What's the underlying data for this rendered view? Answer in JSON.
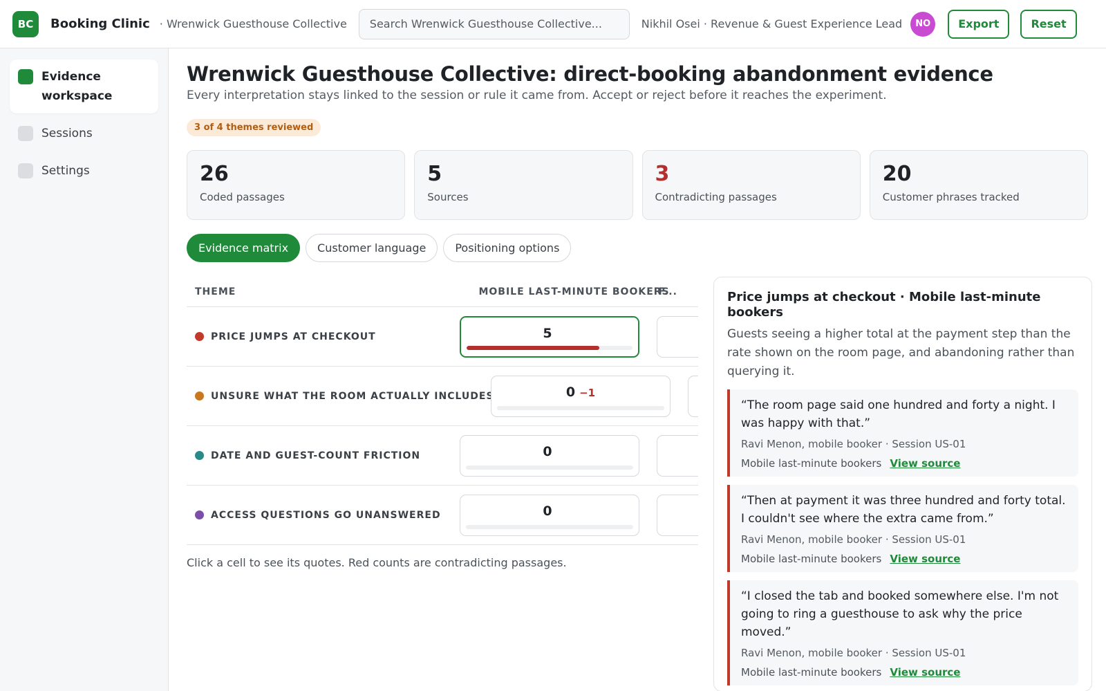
{
  "topbar": {
    "logo_text": "BC",
    "app_name": "Booking Clinic",
    "workspace_name": "· Wrenwick Guesthouse Collective",
    "search_placeholder": "Search Wrenwick Guesthouse Collective...",
    "user_label": "Nikhil Osei · Revenue & Guest Experience Lead",
    "avatar_initials": "NO",
    "avatar_color": "#c94bd1",
    "export_label": "Export",
    "reset_label": "Reset"
  },
  "sidebar": {
    "items": [
      {
        "label": "Evidence workspace",
        "active": true
      },
      {
        "label": "Sessions",
        "active": false
      },
      {
        "label": "Settings",
        "active": false
      }
    ]
  },
  "page": {
    "title": "Wrenwick Guesthouse Collective: direct-booking abandonment evidence",
    "subtitle": "Every interpretation stays linked to the session or rule it came from. Accept or reject before it reaches the experiment.",
    "review_badge": "3 of 4 themes reviewed"
  },
  "stats": [
    {
      "value": "26",
      "label": "Coded passages"
    },
    {
      "value": "5",
      "label": "Sources"
    },
    {
      "value": "3",
      "label": "Contradicting passages"
    },
    {
      "value": "20",
      "label": "Customer phrases tracked"
    }
  ],
  "tabs": [
    {
      "label": "Evidence matrix",
      "active": true
    },
    {
      "label": "Customer language",
      "active": false
    },
    {
      "label": "Positioning options",
      "active": false
    }
  ],
  "matrix": {
    "headers": {
      "theme": "Theme",
      "col1": "Mobile last-minute bookers",
      "col2": "F..."
    },
    "rows": [
      {
        "theme": "Price jumps at checkout",
        "color": "#c0392b",
        "count": "5",
        "delta": "",
        "fill": 0.8,
        "selected": true
      },
      {
        "theme": "Unsure what the room actually includes",
        "color": "#c8781e",
        "count": "0",
        "delta": "−1",
        "fill": 0,
        "selected": false
      },
      {
        "theme": "Date and guest-count friction",
        "color": "#2a8a8a",
        "count": "0",
        "delta": "",
        "fill": 0,
        "selected": false
      },
      {
        "theme": "Access questions go unanswered",
        "color": "#7b4fa8",
        "count": "0",
        "delta": "",
        "fill": 0,
        "selected": false
      }
    ],
    "footnote": "Click a cell to see its quotes. Red counts are contradicting passages."
  },
  "detail": {
    "title": "Price jumps at checkout · Mobile last-minute bookers",
    "description": "Guests seeing a higher total at the payment step than the rate shown on the room page, and abandoning rather than querying it.",
    "quotes": [
      {
        "text": "“The room page said one hundred and forty a night. I was happy with that.”",
        "meta": "Ravi Menon, mobile booker · Session US-01",
        "segment": "Mobile last-minute bookers",
        "link": "View source"
      },
      {
        "text": "“Then at payment it was three hundred and forty total. I couldn't see where the extra came from.”",
        "meta": "Ravi Menon, mobile booker · Session US-01",
        "segment": "Mobile last-minute bookers",
        "link": "View source"
      },
      {
        "text": "“I closed the tab and booked somewhere else. I'm not going to ring a guesthouse to ask why the price moved.”",
        "meta": "Ravi Menon, mobile booker · Session US-01",
        "segment": "Mobile last-minute bookers",
        "link": "View source"
      }
    ]
  },
  "colors": {
    "brand": "#1f8a3a",
    "contradiction": "#b3302e",
    "badge_bg": "#fbead8",
    "badge_text": "#b05e12"
  }
}
